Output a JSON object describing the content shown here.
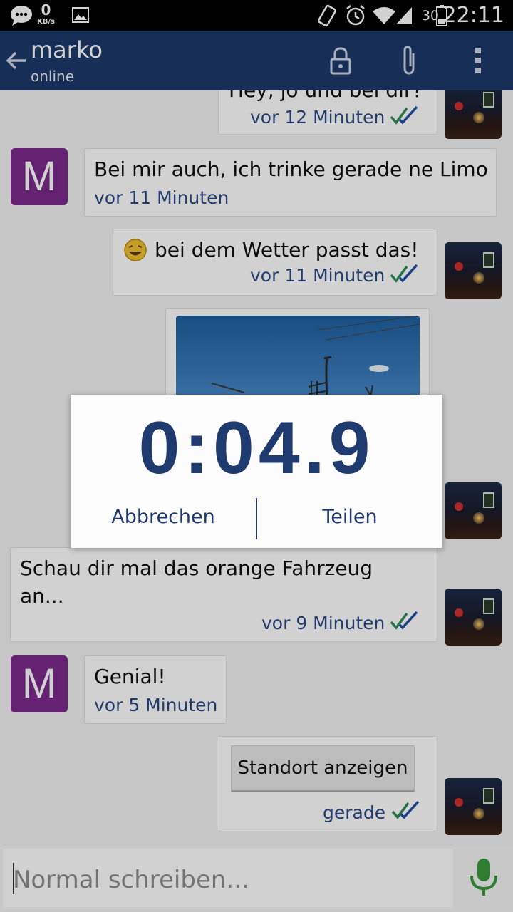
{
  "status_bar": {
    "net_speed_value": "0",
    "net_speed_unit": "KB/s",
    "battery_percent": "30",
    "time": "22:11"
  },
  "app_bar": {
    "title": "marko",
    "subtitle": "online"
  },
  "messages": [
    {
      "text": "Hey, jo und bei dir?",
      "time": "vor 12 Minuten"
    },
    {
      "text": "Bei mir auch, ich trinke gerade ne Limo",
      "time": "vor 11 Minuten"
    },
    {
      "text": "bei dem Wetter passt das!",
      "time": "vor 11 Minuten"
    },
    {
      "text_line1": "Schau dir mal das orange Fahrzeug",
      "text_line2": "an...",
      "time": "vor 9 Minuten"
    },
    {
      "text": "Genial!",
      "time": "vor 5 Minuten"
    },
    {
      "button_label": "Standort anzeigen",
      "time": "gerade"
    }
  ],
  "avatar_letter": "M",
  "dialog": {
    "timer": "0:04.9",
    "cancel_label": "Abbrechen",
    "share_label": "Teilen"
  },
  "input": {
    "placeholder": "Normal schreiben..."
  },
  "colors": {
    "app_bar": "#1d3a6a",
    "accent_text": "#2b4a86",
    "avatar": "#7d2a8c",
    "mic": "#3a9a3a"
  }
}
